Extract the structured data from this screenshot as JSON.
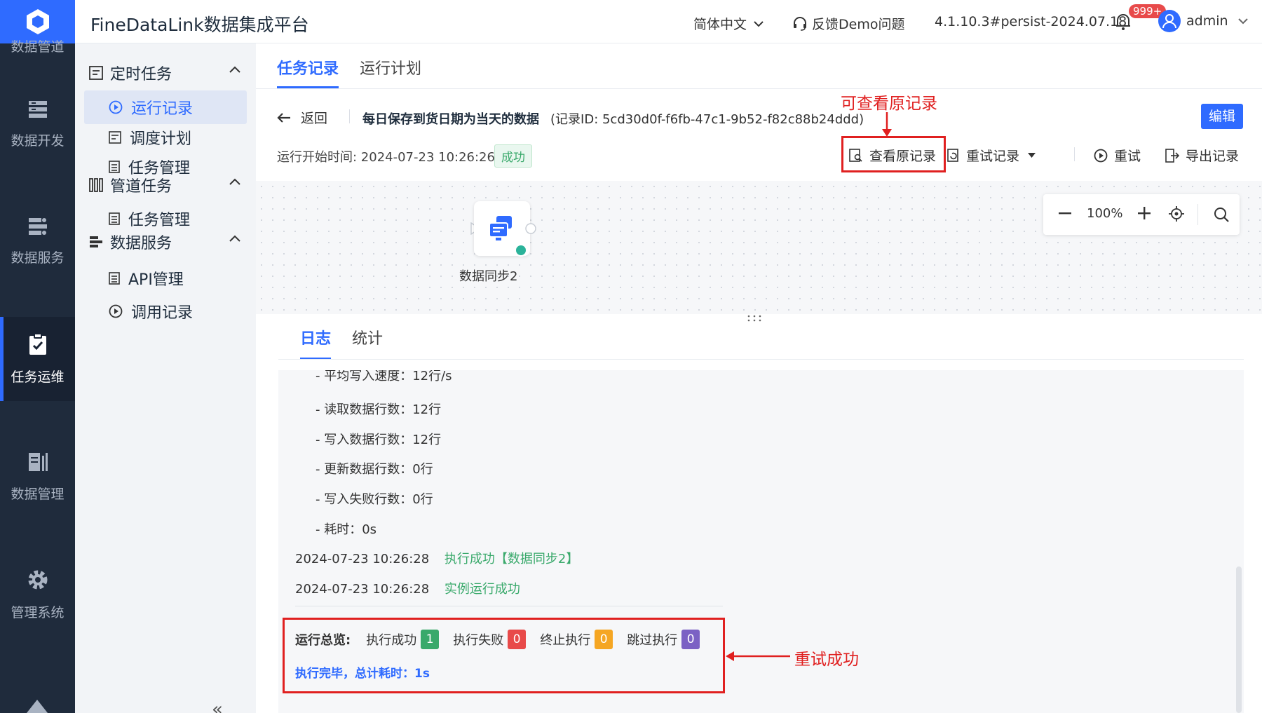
{
  "app": {
    "title": "FineDataLink数据集成平台",
    "language": "简体中文",
    "feedback": "反馈Demo问题",
    "version": "4.1.10.3#persist-2024.07.18",
    "notification_count": "999+",
    "user": "admin"
  },
  "rail": {
    "items": [
      {
        "label": "数据管道"
      },
      {
        "label": "数据开发"
      },
      {
        "label": "数据服务"
      },
      {
        "label": "任务运维"
      },
      {
        "label": "数据管理"
      },
      {
        "label": "管理系统"
      }
    ]
  },
  "submenu": {
    "groups": [
      {
        "label": "定时任务"
      },
      {
        "label": "管道任务"
      },
      {
        "label": "数据服务"
      }
    ],
    "items": [
      {
        "label": "运行记录"
      },
      {
        "label": "调度计划"
      },
      {
        "label": "任务管理"
      },
      {
        "label": "任务管理"
      },
      {
        "label": "API管理"
      },
      {
        "label": "调用记录"
      }
    ],
    "collapse_label": "«"
  },
  "main": {
    "tabs": [
      {
        "label": "任务记录"
      },
      {
        "label": "运行计划"
      }
    ],
    "back_label": "返回",
    "task_name": "每日保存到货日期为当天的数据",
    "record_id": "(记录ID: 5cd30d0f-f6fb-47c1-9b52-f82c88b24ddd)",
    "edit_label": "编辑",
    "start_time": "运行开始时间: 2024-07-23 10:26:26",
    "status": "成功",
    "actions": {
      "view_original": "查看原记录",
      "retry_records": "重试记录",
      "retry": "重试",
      "export": "导出记录"
    }
  },
  "canvas": {
    "zoom": "100%",
    "node_label": "数据同步2"
  },
  "log": {
    "tabs": [
      {
        "label": "日志"
      },
      {
        "label": "统计"
      }
    ],
    "lines": [
      "- 平均写入速度：12行/s",
      "- 读取数据行数：12行",
      "- 写入数据行数：12行",
      "- 更新数据行数：0行",
      "- 写入失败行数：0行",
      "- 耗时：0s"
    ],
    "events": [
      {
        "time": "2024-07-23 10:26:28",
        "msg": "执行成功【数据同步2】"
      },
      {
        "time": "2024-07-23 10:26:28",
        "msg": "实例运行成功"
      }
    ],
    "summary": {
      "label": "运行总览:",
      "success_label": "执行成功",
      "success": "1",
      "fail_label": "执行失败",
      "fail": "0",
      "stop_label": "终止执行",
      "stop": "0",
      "skip_label": "跳过执行",
      "skip": "0",
      "finish": "执行完毕，总计耗时：1s"
    }
  },
  "annotations": {
    "view_original": "可查看原记录",
    "retry_success": "重试成功"
  },
  "colors": {
    "accent": "#2f6bff",
    "rail": "#1f2b3c",
    "success": "#39a96b",
    "fail": "#e84a4a",
    "stop": "#f5a623",
    "skip": "#7b61c4",
    "annotation": "#e02020"
  }
}
